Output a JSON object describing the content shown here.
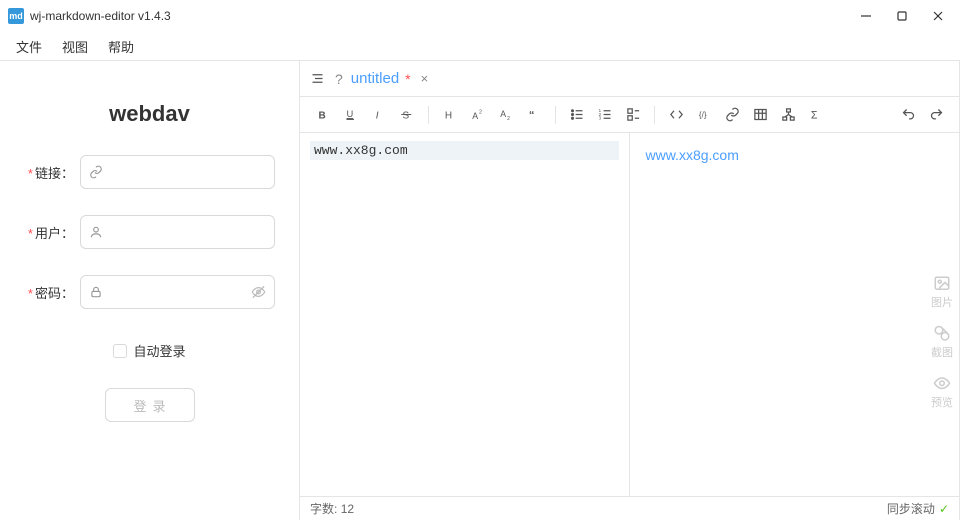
{
  "window": {
    "logo": "md",
    "title": "wj-markdown-editor v1.4.3"
  },
  "menu": {
    "file": "文件",
    "view": "视图",
    "help": "帮助"
  },
  "sidebar": {
    "title": "webdav",
    "link_label": "链接：",
    "user_label": "用户：",
    "pass_label": "密码：",
    "auto_login": "自动登录",
    "login_btn": "登录"
  },
  "tab": {
    "q": "?",
    "name": "untitled",
    "star": "*",
    "close": "×"
  },
  "editor": {
    "source": "www.xx8g.com",
    "preview_link": "www.xx8g.com"
  },
  "side_tools": {
    "image": "图片",
    "screenshot": "截图",
    "preview": "预览"
  },
  "status": {
    "word_label": "字数:",
    "word_count": "12",
    "sync_scroll": "同步滚动",
    "check": "✓"
  }
}
